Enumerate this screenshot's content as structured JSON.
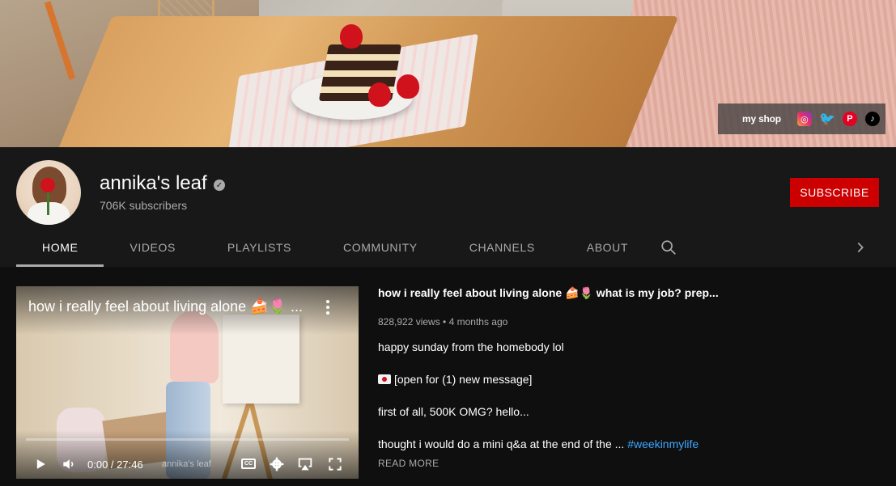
{
  "banner": {
    "shop_label": "my shop",
    "social_icons": [
      "instagram-icon",
      "twitter-icon",
      "pinterest-icon",
      "tiktok-icon"
    ]
  },
  "channel": {
    "name": "annika's leaf",
    "subscribers": "706K subscribers",
    "subscribe_label": "SUBSCRIBE",
    "verified_mark": "✓"
  },
  "tabs": [
    {
      "label": "HOME",
      "active": true
    },
    {
      "label": "VIDEOS",
      "active": false
    },
    {
      "label": "PLAYLISTS",
      "active": false
    },
    {
      "label": "COMMUNITY",
      "active": false
    },
    {
      "label": "CHANNELS",
      "active": false
    },
    {
      "label": "ABOUT",
      "active": false
    }
  ],
  "featured": {
    "player_title": "how i really feel about living alone 🍰🌷 ...",
    "time": "0:00 / 27:46",
    "watermark": "annika's leaf",
    "cc_label": "CC",
    "title": "how i really feel about living alone 🍰🌷 what is my job? prep...",
    "meta": "828,922 views • 4 months ago",
    "desc_line1": "happy sunday from the homebody lol",
    "desc_line2": "[open for (1) new message]",
    "desc_line3": "first of all, 500K OMG? hello...",
    "desc_line4": "thought i would do a mini q&a at the end of the ... ",
    "hashtag": "#weekinmylife",
    "read_more": "READ MORE"
  },
  "colors": {
    "subscribe": "#cc0000",
    "background": "#181818",
    "content_bg": "#0f0f0f",
    "hashtag": "#3ea6ff"
  }
}
